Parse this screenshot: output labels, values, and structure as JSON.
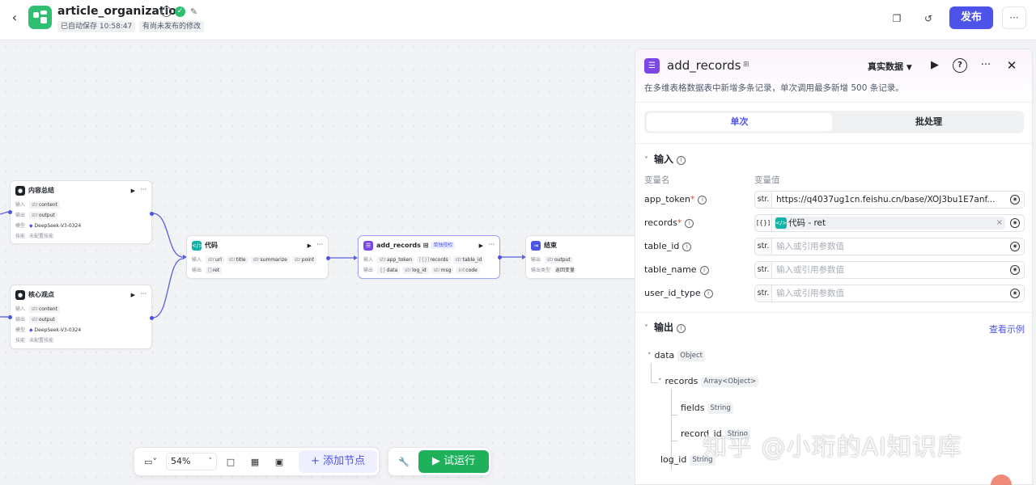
{
  "header": {
    "app_title": "article_organization",
    "autosave": "已自动保存 10:58:47",
    "unpublished": "有尚未发布的修改",
    "publish_label": "发布"
  },
  "canvas": {
    "nodes": {
      "summary": {
        "title": "内容总结",
        "input_label": "输入",
        "input_param": "content",
        "output_label": "输出",
        "output_param": "output",
        "model_label": "模型",
        "model": "DeepSeek-V3-0324",
        "skill_label": "技能",
        "skill": "未配置技能"
      },
      "viewpoint": {
        "title": "核心观点",
        "input_label": "输入",
        "input_param": "content",
        "output_label": "输出",
        "output_param": "output",
        "model_label": "模型",
        "model": "DeepSeek-V3-0324",
        "skill_label": "技能",
        "skill": "未配置技能"
      },
      "code": {
        "title": "代码",
        "input_label": "输入",
        "inputs": [
          "url",
          "title",
          "summarize",
          "point"
        ],
        "output_label": "输出",
        "output_param": "ret"
      },
      "add_records": {
        "title": "add_records",
        "badge": "单独授权",
        "input_label": "输入",
        "inputs": [
          "app_token",
          "records",
          "table_id"
        ],
        "output_label": "输出",
        "outputs": [
          "data",
          "log_id",
          "msg",
          "code"
        ]
      },
      "end": {
        "title": "结束",
        "output_label": "输出",
        "output_param": "output",
        "return_label": "输出类型",
        "return_value": "返回变量"
      }
    }
  },
  "toolbar": {
    "zoom": "54%",
    "add_node_label": "添加节点",
    "run_label": "试运行"
  },
  "panel": {
    "title": "add_records",
    "mode": "真实数据",
    "description": "在多维表格数据表中新增多条记录，单次调用最多新增 500 条记录。",
    "tabs": [
      "单次",
      "批处理"
    ],
    "input_section": "输入",
    "col_name": "变量名",
    "col_value": "变量值",
    "fields": [
      {
        "name": "app_token",
        "type": "str.",
        "value": "https://q4037ug1cn.feishu.cn/base/XOJ3bu1E7anf..."
      },
      {
        "name": "records",
        "type": "[{}]",
        "ref": "代码 - ret"
      },
      {
        "name": "table_id",
        "type": "str.",
        "placeholder": "输入或引用参数值"
      },
      {
        "name": "table_name",
        "type": "str.",
        "placeholder": "输入或引用参数值"
      },
      {
        "name": "user_id_type",
        "type": "str.",
        "placeholder": "输入或引用参数值"
      }
    ],
    "output_section": "输出",
    "view_example": "查看示例",
    "outputs": {
      "data": {
        "name": "data",
        "type": "Object"
      },
      "records": {
        "name": "records",
        "type": "Array<Object>"
      },
      "fields": {
        "name": "fields",
        "type": "String"
      },
      "record_id": {
        "name": "record_id",
        "type": "String"
      },
      "log_id": {
        "name": "log_id",
        "type": "String"
      }
    }
  },
  "watermark": "知乎 @小珩的AI知识库",
  "colors": {
    "accent": "#4d53e8",
    "run_green": "#1fb05c",
    "logo_green": "#2fbf71",
    "plugin_purple": "#7b47e6",
    "code_teal": "#11b2a8"
  }
}
